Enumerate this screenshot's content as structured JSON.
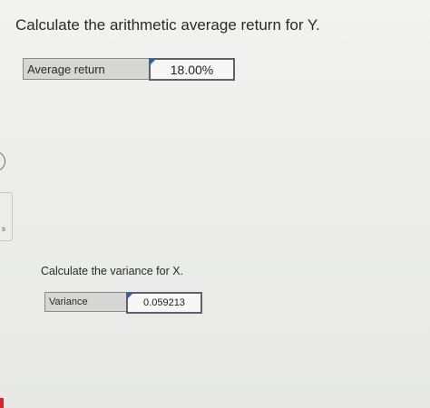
{
  "question1": {
    "text": "Calculate the arithmetic average return for Y.",
    "label": "Average return",
    "value": "18.00%"
  },
  "question2": {
    "text": "Calculate the variance for X.",
    "label": "Variance",
    "value": "0.059213"
  },
  "left_edge": {
    "partial_letter": "s"
  },
  "colors": {
    "label_cell_bg": "#d6d7d5",
    "value_cell_bg": "#f7f7f6",
    "value_border": "#5e6168",
    "flag_blue": "#2a5fb0",
    "edge_marker_red": "#d12a2a"
  }
}
